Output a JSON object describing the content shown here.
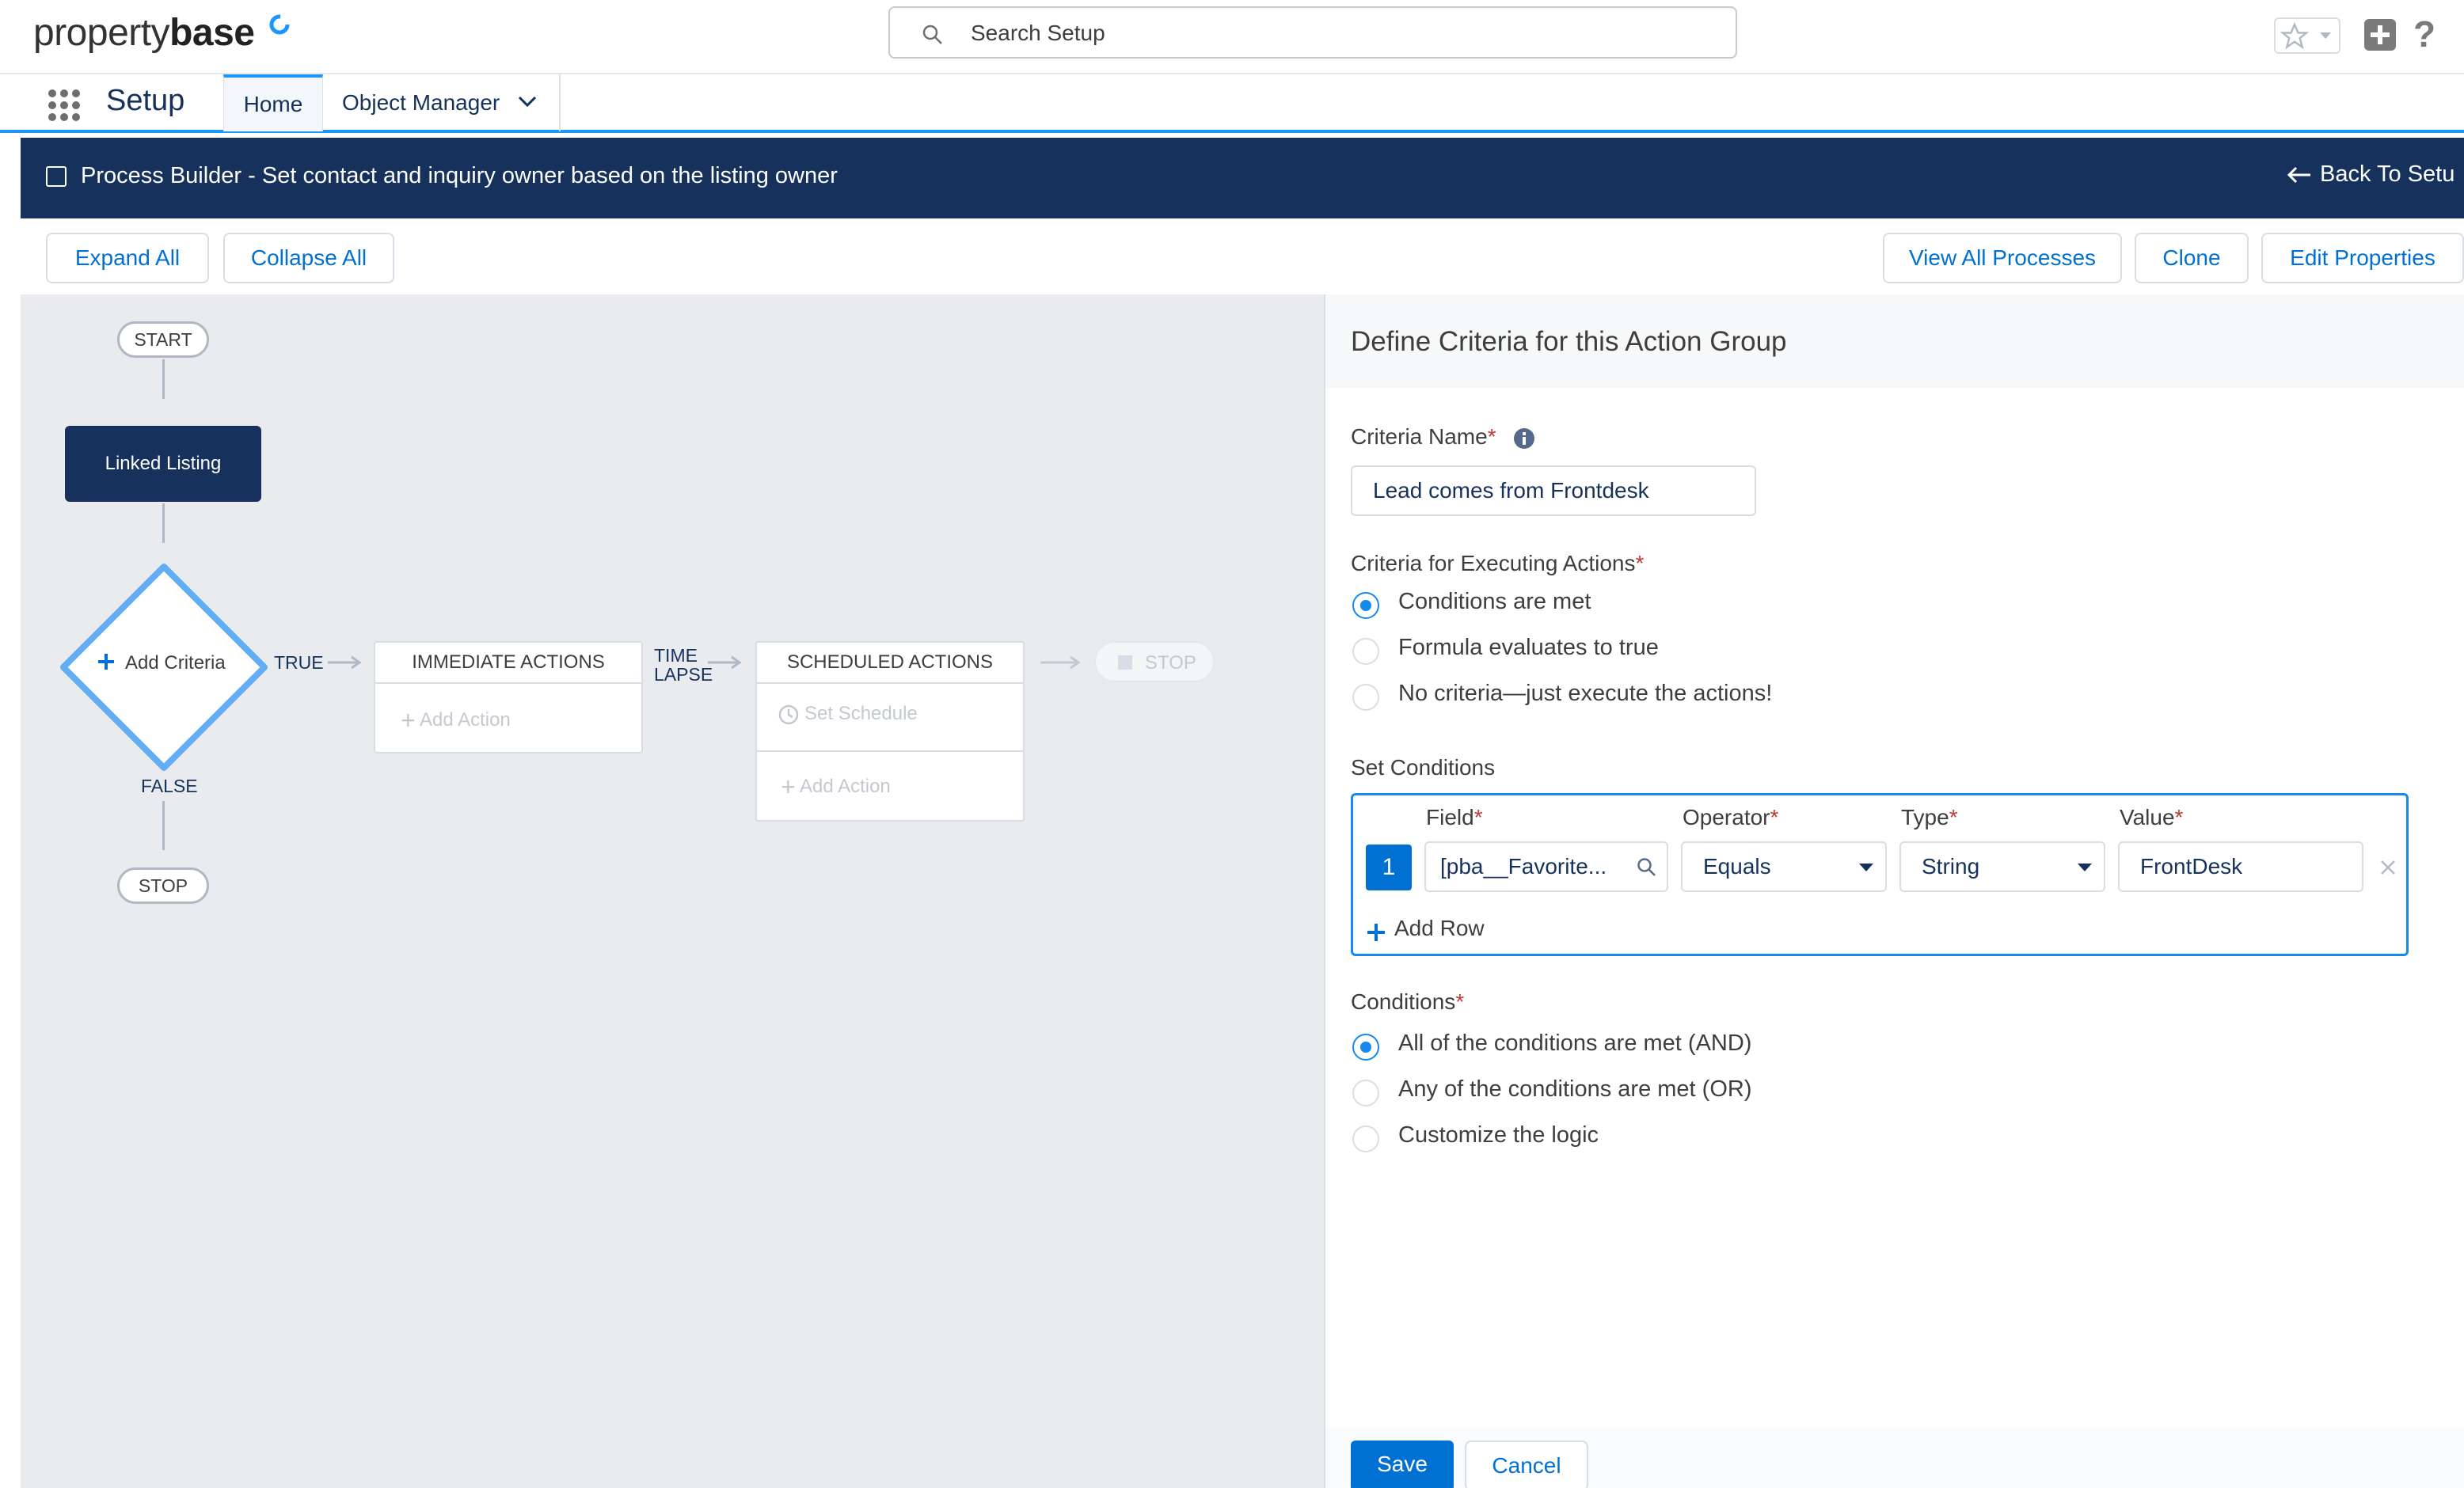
{
  "brand": {
    "name_light": "property",
    "name_bold": "base",
    "accent": "#1b96ff"
  },
  "search": {
    "placeholder": "Search Setup"
  },
  "header_icons": [
    "star-icon",
    "chevron-down-icon",
    "plus-icon",
    "help-icon"
  ],
  "nav": {
    "app_title": "Setup",
    "tabs": [
      "Home",
      "Object Manager"
    ]
  },
  "banner": {
    "title": "Process Builder - Set contact and inquiry owner based on the listing owner",
    "back_label": "Back To Setu"
  },
  "toolbar": {
    "expand_all": "Expand All",
    "collapse_all": "Collapse All",
    "view_all_processes": "View All Processes",
    "clone": "Clone",
    "edit_properties": "Edit Properties"
  },
  "flow": {
    "start": "START",
    "object_node": "Linked Listing",
    "criteria_node": "Add Criteria",
    "true_label": "TRUE",
    "false_label": "FALSE",
    "stop": "STOP",
    "immediate_actions": "IMMEDIATE ACTIONS",
    "add_action": "Add Action",
    "time_lapse_1": "TIME",
    "time_lapse_2": "LAPSE",
    "scheduled_actions": "SCHEDULED ACTIONS",
    "set_schedule": "Set Schedule",
    "add_action_2": "Add Action",
    "stop_disabled": "STOP"
  },
  "panel": {
    "title": "Define Criteria for this Action Group",
    "criteria_name_label": "Criteria Name",
    "criteria_name_value": "Lead comes from Frontdesk",
    "executing_label": "Criteria for Executing Actions",
    "executing_options": [
      "Conditions are met",
      "Formula evaluates to true",
      "No criteria—just execute the actions!"
    ],
    "executing_selected": 0,
    "set_conditions_label": "Set Conditions",
    "columns": {
      "field": "Field",
      "operator": "Operator",
      "type": "Type",
      "value": "Value"
    },
    "row": {
      "number": "1",
      "field": "[pba__Favorite...",
      "operator": "Equals",
      "type": "String",
      "value": "FrontDesk"
    },
    "add_row": "Add Row",
    "conditions_label": "Conditions",
    "conditions_options": [
      "All of the conditions are met (AND)",
      "Any of the conditions are met (OR)",
      "Customize the logic"
    ],
    "conditions_selected": 0,
    "save": "Save",
    "cancel": "Cancel"
  }
}
